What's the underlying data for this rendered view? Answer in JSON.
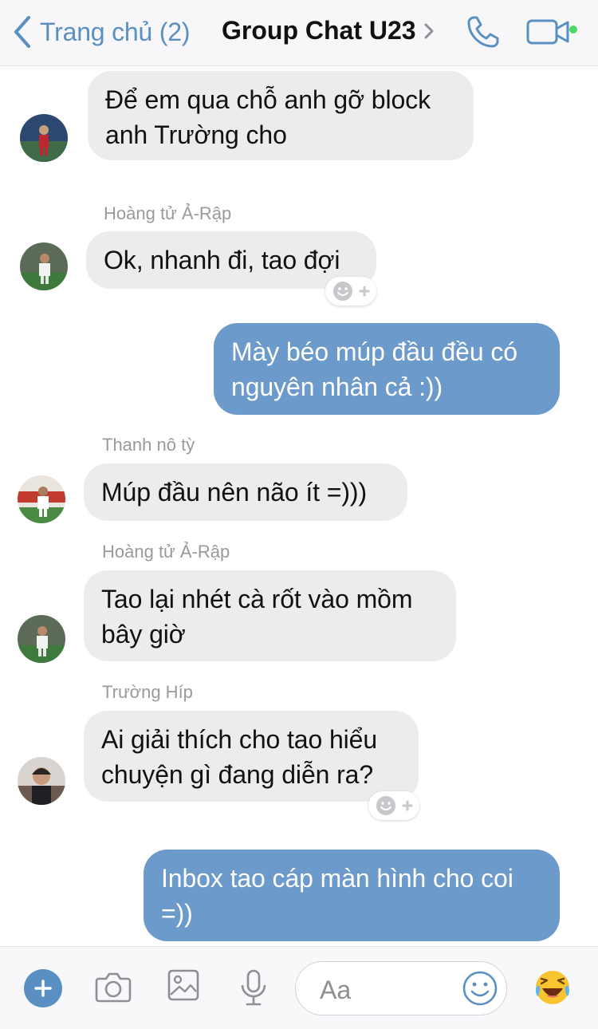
{
  "header": {
    "back_label": "Trang chủ (2)",
    "title": "Group Chat U23",
    "back_icon": "chevron-left-icon",
    "title_chevron_icon": "chevron-right-icon",
    "call_icon": "phone-icon",
    "video_icon": "video-camera-icon",
    "accent_color": "#5a8fc2",
    "online_color": "#4cd964"
  },
  "messages": [
    {
      "direction": "incoming",
      "sender": "",
      "lines": [
        "Để em qua chỗ anh gỡ block",
        "anh Trường cho"
      ]
    },
    {
      "direction": "incoming",
      "sender": "Hoàng tử Ả-Rập",
      "lines": [
        "Ok, nhanh đi, tao đợi"
      ],
      "reaction_add": true
    },
    {
      "direction": "outgoing",
      "sender": "",
      "lines": [
        "Mày béo múp đầu đều có",
        "nguyên nhân cả :))"
      ]
    },
    {
      "direction": "incoming",
      "sender": "Thanh nô tỳ",
      "lines": [
        "Múp đầu nên não ít =)))"
      ]
    },
    {
      "direction": "incoming",
      "sender": "Hoàng tử Ả-Rập",
      "lines": [
        "Tao lại nhét cà rốt vào mồm",
        "bây giờ"
      ]
    },
    {
      "direction": "incoming",
      "sender": "Trường Híp",
      "lines": [
        "Ai giải thích cho tao hiểu",
        "chuyện gì đang diễn ra?"
      ],
      "reaction_add": true
    },
    {
      "direction": "outgoing",
      "sender": "",
      "lines": [
        "Inbox tao cáp màn hình cho coi",
        "=))"
      ]
    }
  ],
  "bubble_colors": {
    "incoming": "#ececee",
    "outgoing": "#6b9acb"
  },
  "composer": {
    "placeholder": "Aa",
    "tools": [
      "plus-icon",
      "camera-icon",
      "image-icon",
      "microphone-icon",
      "smiley-icon",
      "laughing-emoji-icon"
    ]
  }
}
